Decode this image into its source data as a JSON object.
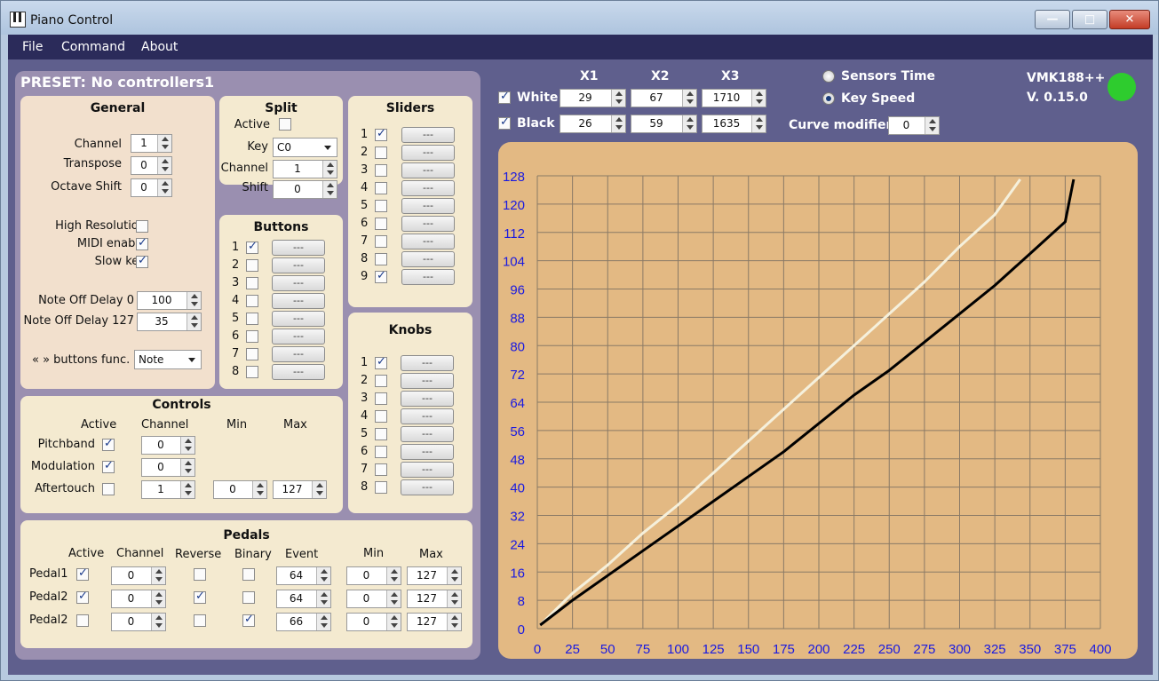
{
  "window": {
    "title": "Piano Control"
  },
  "menu": [
    "File",
    "Command",
    "About"
  ],
  "preset": "PRESET:  No controllers1",
  "general": {
    "title": "General",
    "channel_label": "Channel",
    "channel": "1",
    "transpose_label": "Transpose",
    "transpose": "0",
    "octave_label": "Octave Shift",
    "octave": "0",
    "hires_label": "High Resolution",
    "hires": false,
    "midi_label": "MIDI enable",
    "midi": true,
    "slowkey_label": "Slow key",
    "slowkey": true,
    "noteoff0_label": "Note Off Delay 0",
    "noteoff0": "100",
    "noteoff127_label": "Note Off Delay 127",
    "noteoff127": "35",
    "buttonsfunc_label": "« » buttons func.",
    "buttonsfunc": "Note"
  },
  "split": {
    "title": "Split",
    "active_label": "Active",
    "active": false,
    "key_label": "Key",
    "key": "C0",
    "channel_label": "Channel",
    "channel": "1",
    "shift_label": "Shift",
    "shift": "0"
  },
  "buttons": {
    "title": "Buttons",
    "btn_label": "---",
    "items": [
      {
        "n": "1",
        "checked": true
      },
      {
        "n": "2",
        "checked": false
      },
      {
        "n": "3",
        "checked": false
      },
      {
        "n": "4",
        "checked": false
      },
      {
        "n": "5",
        "checked": false
      },
      {
        "n": "6",
        "checked": false
      },
      {
        "n": "7",
        "checked": false
      },
      {
        "n": "8",
        "checked": false
      }
    ]
  },
  "sliders": {
    "title": "Sliders",
    "btn_label": "---",
    "items": [
      {
        "n": "1",
        "checked": true
      },
      {
        "n": "2",
        "checked": false
      },
      {
        "n": "3",
        "checked": false
      },
      {
        "n": "4",
        "checked": false
      },
      {
        "n": "5",
        "checked": false
      },
      {
        "n": "6",
        "checked": false
      },
      {
        "n": "7",
        "checked": false
      },
      {
        "n": "8",
        "checked": false
      },
      {
        "n": "9",
        "checked": true
      }
    ]
  },
  "knobs": {
    "title": "Knobs",
    "btn_label": "---",
    "items": [
      {
        "n": "1",
        "checked": true
      },
      {
        "n": "2",
        "checked": false
      },
      {
        "n": "3",
        "checked": false
      },
      {
        "n": "4",
        "checked": false
      },
      {
        "n": "5",
        "checked": false
      },
      {
        "n": "6",
        "checked": false
      },
      {
        "n": "7",
        "checked": false
      },
      {
        "n": "8",
        "checked": false
      }
    ]
  },
  "controls": {
    "title": "Controls",
    "headers": {
      "active": "Active",
      "channel": "Channel",
      "min": "Min",
      "max": "Max"
    },
    "rows": [
      {
        "name": "Pitchband",
        "active": true,
        "channel": "0"
      },
      {
        "name": "Modulation",
        "active": true,
        "channel": "0"
      },
      {
        "name": "Aftertouch",
        "active": false,
        "channel": "1",
        "min": "0",
        "max": "127"
      }
    ]
  },
  "pedals": {
    "title": "Pedals",
    "headers": {
      "active": "Active",
      "channel": "Channel",
      "reverse": "Reverse",
      "binary": "Binary",
      "event": "Event",
      "min": "Min",
      "max": "Max"
    },
    "rows": [
      {
        "name": "Pedal1",
        "active": true,
        "channel": "0",
        "reverse": false,
        "binary": false,
        "event": "64",
        "min": "0",
        "max": "127"
      },
      {
        "name": "Pedal2",
        "active": true,
        "channel": "0",
        "reverse": true,
        "binary": false,
        "event": "64",
        "min": "0",
        "max": "127"
      },
      {
        "name": "Pedal2",
        "active": false,
        "channel": "0",
        "reverse": false,
        "binary": true,
        "event": "66",
        "min": "0",
        "max": "127"
      }
    ]
  },
  "curve": {
    "headers": {
      "x1": "X1",
      "x2": "X2",
      "x3": "X3"
    },
    "white": {
      "label": "White",
      "checked": true,
      "x1": "29",
      "x2": "67",
      "x3": "1710"
    },
    "black": {
      "label": "Black",
      "checked": true,
      "x1": "26",
      "x2": "59",
      "x3": "1635"
    },
    "sensors_label": "Sensors Time",
    "sensors_selected": false,
    "keyspeed_label": "Key Speed",
    "keyspeed_selected": true,
    "modifier_label": "Curve modifier",
    "modifier": "0"
  },
  "device": {
    "name": "VMK188++",
    "version": "V. 0.15.0",
    "status_color": "#2ecc2e"
  },
  "chart_data": {
    "type": "line",
    "xlim": [
      0,
      400
    ],
    "ylim": [
      0,
      128
    ],
    "xticks": [
      0,
      25,
      50,
      75,
      100,
      125,
      150,
      175,
      200,
      225,
      250,
      275,
      300,
      325,
      350,
      375,
      400
    ],
    "yticks": [
      0,
      8,
      16,
      24,
      32,
      40,
      48,
      56,
      64,
      72,
      80,
      88,
      96,
      104,
      112,
      120,
      128
    ],
    "grid": true,
    "series": [
      {
        "color": "#f5f0dc",
        "x": [
          2,
          25,
          50,
          75,
          100,
          125,
          150,
          175,
          200,
          225,
          250,
          275,
          300,
          325,
          343
        ],
        "y": [
          1,
          10,
          18,
          27,
          35,
          44,
          53,
          62,
          71,
          80,
          89,
          98,
          108,
          117,
          127
        ]
      },
      {
        "color": "#000000",
        "x": [
          2,
          25,
          50,
          75,
          100,
          125,
          150,
          175,
          200,
          225,
          250,
          275,
          300,
          325,
          350,
          375,
          381
        ],
        "y": [
          1,
          8,
          15,
          22,
          29,
          36,
          43,
          50,
          58,
          66,
          73,
          81,
          89,
          97,
          106,
          115,
          127
        ]
      }
    ]
  }
}
